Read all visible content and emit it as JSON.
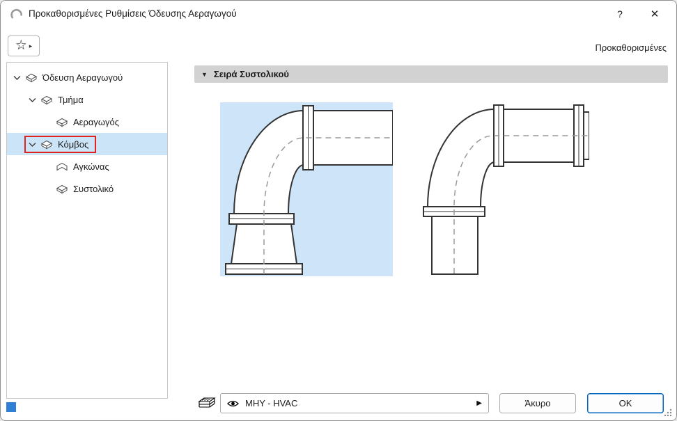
{
  "window": {
    "title": "Προκαθορισμένες Ρυθμίσεις Όδευσης Αεραγωγού",
    "help_label": "?",
    "close_label": "✕"
  },
  "toolbar": {
    "favorites_label": "Προκαθορισμένες",
    "star_glyph": "☆",
    "flyout_glyph": "▸"
  },
  "tree": {
    "items": [
      {
        "label": "Όδευση Αεραγωγού",
        "level": 0,
        "expanded": true
      },
      {
        "label": "Τμήμα",
        "level": 1,
        "expanded": true
      },
      {
        "label": "Αεραγωγός",
        "level": 2
      },
      {
        "label": "Κόμβος",
        "level": 1,
        "expanded": true,
        "selected": true,
        "highlighted": true
      },
      {
        "label": "Αγκώνας",
        "level": 2
      },
      {
        "label": "Συστολικό",
        "level": 2
      }
    ],
    "selected_item": "Κόμβος"
  },
  "panel": {
    "header": "Σειρά Συστολικού",
    "collapse_glyph": "▼"
  },
  "previews": [
    {
      "name": "reducer-elbow-variant-1",
      "selected": true
    },
    {
      "name": "reducer-elbow-variant-2",
      "selected": false
    }
  ],
  "footer": {
    "layer_value": "MHY - HVAC",
    "combo_arrow_glyph": "▶",
    "cancel_label": "Άκυρο",
    "ok_label": "OK"
  },
  "colors": {
    "tree_selection_bg": "#cce4f7",
    "preview_selected_bg": "#cde4f9",
    "highlight_outline": "#e0231c",
    "ok_button_border": "#0066bf",
    "corner_square": "#2f7fd6"
  }
}
